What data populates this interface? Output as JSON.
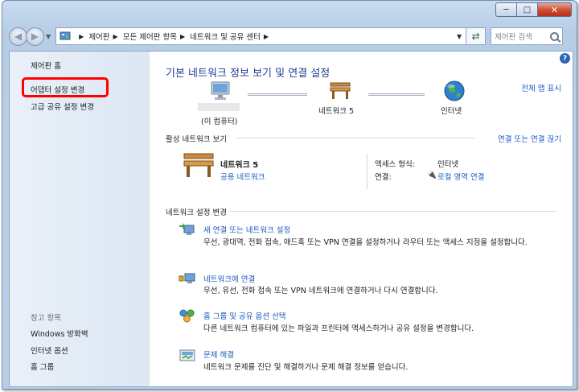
{
  "window": {
    "caption": {
      "minimize": "─",
      "maximize": "□",
      "close": "✕"
    }
  },
  "navbar": {
    "breadcrumbs": [
      "제어판",
      "모든 제어판 항목",
      "네트워크 및 공유 센터"
    ],
    "search_placeholder": "제어판 검색"
  },
  "sidebar": {
    "home": "제어판 홈",
    "links": [
      "어댑터 설정 변경",
      "고급 공유 설정 변경"
    ],
    "see_also_heading": "참고 항목",
    "see_also": [
      "Windows 방화벽",
      "인터넷 옵션",
      "홈 그룹"
    ]
  },
  "main": {
    "help": "?",
    "title": "기본 네트워크 정보 보기 및 연결 설정",
    "full_map_link": "전체 맵 표시",
    "map": {
      "computer_label": "(이 컴퓨터)",
      "network_label": "네트워크  5",
      "internet_label": "인터넷"
    },
    "active_networks": {
      "heading": "활성 네트워크 보기",
      "connect_link": "연결 또는 연결 끊기",
      "network_name": "네트워크  5",
      "network_type": "공용 네트워크",
      "access_type_label": "액세스 형식:",
      "access_type_value": "인터넷",
      "connections_label": "연결:",
      "connections_value": "로컬 영역 연결"
    },
    "change_settings": {
      "heading": "네트워크 설정 변경",
      "tasks": [
        {
          "title": "새 연결 또는 네트워크 설정",
          "desc": "무선, 광대역, 전화 접속, 애드혹 또는 VPN 연결을 설정하거나 라우터 또는 액세스 지점을 설정합니다."
        },
        {
          "title": "네트워크에 연결",
          "desc": "무선, 유선, 전화 접속 또는 VPN 네트워크에 연결하거나 다시 연결합니다."
        },
        {
          "title": "홈 그룹 및 공유 옵션 선택",
          "desc": "다른 네트워크 컴퓨터에 있는 파일과 프린터에 액세스하거나 공유 설정을 변경합니다."
        },
        {
          "title": "문제 해결",
          "desc": "네트워크 문제를 진단 및 해결하거나 문제 해결 정보를 얻습니다."
        }
      ]
    }
  },
  "colors": {
    "link": "#1b5bbf",
    "title": "#1e3d8f",
    "highlight": "#ff0000"
  }
}
